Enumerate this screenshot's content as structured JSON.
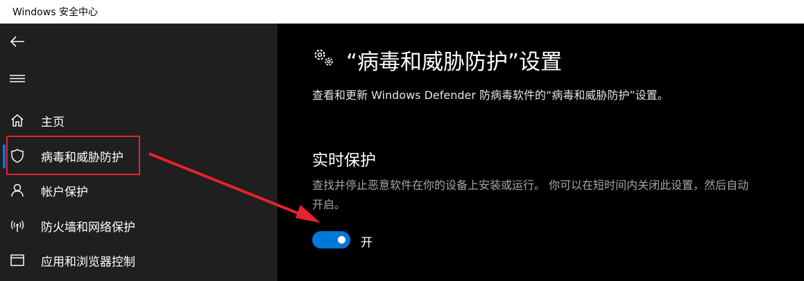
{
  "window": {
    "title": "Windows 安全中心"
  },
  "sidebar": {
    "items": [
      {
        "label": "主页",
        "icon": "home-icon"
      },
      {
        "label": "病毒和威胁防护",
        "icon": "shield-icon",
        "selected": true
      },
      {
        "label": "帐户保护",
        "icon": "person-icon"
      },
      {
        "label": "防火墙和网络保护",
        "icon": "antenna-icon"
      },
      {
        "label": "应用和浏览器控制",
        "icon": "browser-window-icon"
      }
    ]
  },
  "main": {
    "title": "“病毒和威胁防护”设置",
    "description": "查看和更新 Windows Defender 防病毒软件的“病毒和威胁防护”设置。",
    "realtime": {
      "title": "实时保护",
      "description": "查找并停止恶意软件在你的设备上安装或运行。 你可以在短时间内关闭此设置，然后自动开启。",
      "toggle_state": "开",
      "enabled": true
    }
  },
  "colors": {
    "accent": "#0078d7",
    "annotation": "#e8212c",
    "sidebar_bg": "#1f1f1f",
    "main_bg": "#000000"
  }
}
